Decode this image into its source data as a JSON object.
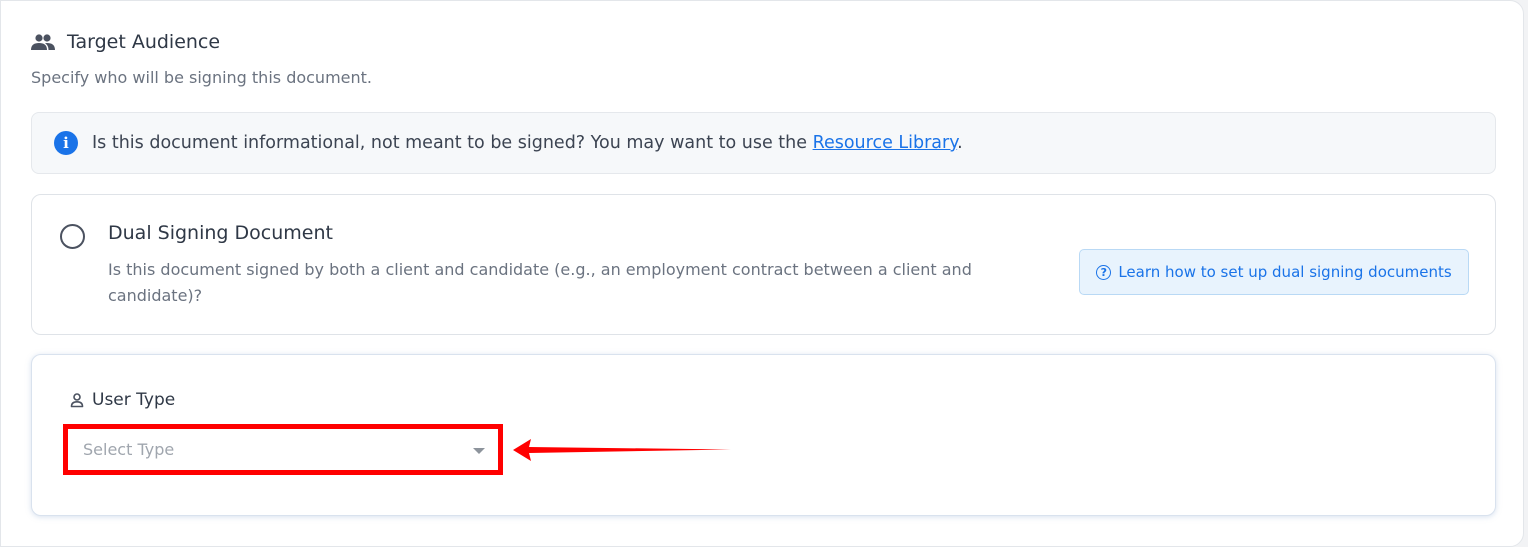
{
  "section": {
    "title": "Target Audience",
    "title_icon": "people-icon",
    "subtitle": "Specify who will be signing this document."
  },
  "info_banner": {
    "icon": "info-icon",
    "icon_glyph": "i",
    "text": "Is this document informational, not meant to be signed? You may want to use the ",
    "link_text": "Resource Library",
    "suffix": "."
  },
  "dual_signing": {
    "title": "Dual Signing Document",
    "description": "Is this document signed by both a client and candidate (e.g., an employment contract between a client and candidate)?",
    "selected": false,
    "learn_button": {
      "icon": "question-circle-icon",
      "icon_glyph": "?",
      "label": "Learn how to set up dual signing documents"
    }
  },
  "user_type": {
    "label": "User Type",
    "label_icon": "user-icon",
    "select": {
      "placeholder": "Select Type",
      "value": ""
    }
  },
  "colors": {
    "accent": "#1a73e8",
    "highlight": "#ff0000"
  }
}
